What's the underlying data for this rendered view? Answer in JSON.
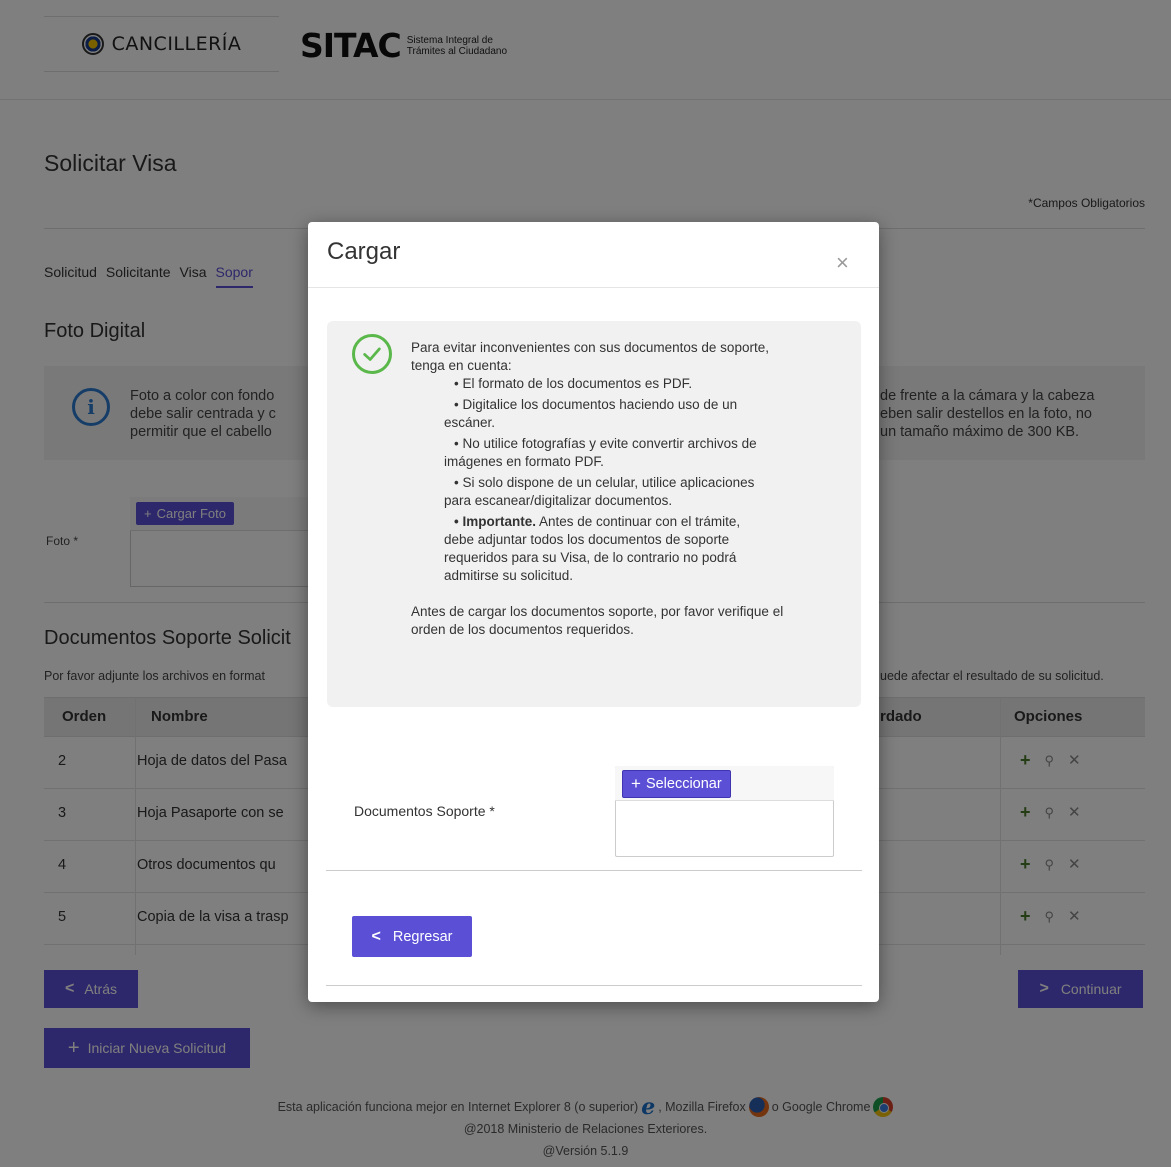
{
  "header": {
    "cancilleria": "CANCILLERÍA",
    "sitac": "SITAC",
    "sitac_sub": "Sistema Integral de Trámites al Ciudadano"
  },
  "page": {
    "title": "Solicitar Visa",
    "obligatorios": "*Campos Obligatorios"
  },
  "tabs": [
    "Solicitud",
    "Solicitante",
    "Visa",
    "Sopor"
  ],
  "foto": {
    "section_title": "Foto Digital",
    "info_left": [
      "Foto a color con fondo",
      "debe salir centrada y c",
      "permitir que el cabello"
    ],
    "info_right": [
      "de frente a la cámara y la cabeza",
      "eben salir destellos en la foto, no",
      "un tamaño máximo de 300 KB."
    ],
    "label": "Foto *",
    "button": "Cargar Foto"
  },
  "docs": {
    "title": "Documentos Soporte Solicit",
    "desc_left": "Por favor adjunte los archivos en format",
    "desc_right": "uede afectar el resultado de su solicitud.",
    "headers": {
      "orden": "Orden",
      "nombre": "Nombre",
      "guardado": "rdado",
      "opciones": "Opciones"
    },
    "rows": [
      {
        "orden": "2",
        "nombre": "Hoja de datos del Pasa"
      },
      {
        "orden": "3",
        "nombre": "Hoja Pasaporte con se"
      },
      {
        "orden": "4",
        "nombre": "Otros documentos qu"
      },
      {
        "orden": "5",
        "nombre": "Copia de la visa a trasp"
      }
    ]
  },
  "buttons": {
    "atras": "Atrás",
    "continuar": "Continuar",
    "nueva": "Iniciar Nueva Solicitud"
  },
  "footer": {
    "line1_a": "Esta aplicación funciona mejor en Internet Explorer 8 (o superior)",
    "line1_b": ", Mozilla Firefox",
    "line1_c": "o Google Chrome",
    "line2": "@2018 Ministerio de Relaciones Exteriores.",
    "line3": "@Versión 5.1.9"
  },
  "modal": {
    "title": "Cargar",
    "close": "×",
    "intro": "Para evitar inconvenientes con sus documentos de soporte, tenga en cuenta:",
    "bullets": [
      "• El formato de los documentos es PDF.",
      "• Digitalice los documentos haciendo uso de un escáner.",
      "• No utilice fotografías y evite convertir archivos de imágenes en formato PDF.",
      "• Si solo dispone de un celular, utilice aplicaciones para escanear/digitalizar documentos."
    ],
    "important_label": "• Importante.",
    "important_text": " Antes de continuar con el trámite, debe adjuntar todos los documentos de soporte requeridos para su Visa, de lo contrario no podrá admitirse su solicitud.",
    "final": "Antes de cargar los documentos soporte, por favor verifique el orden de los documentos requeridos.",
    "docs_label": "Documentos Soporte *",
    "select_button": "Seleccionar",
    "back_button": "Regresar"
  }
}
